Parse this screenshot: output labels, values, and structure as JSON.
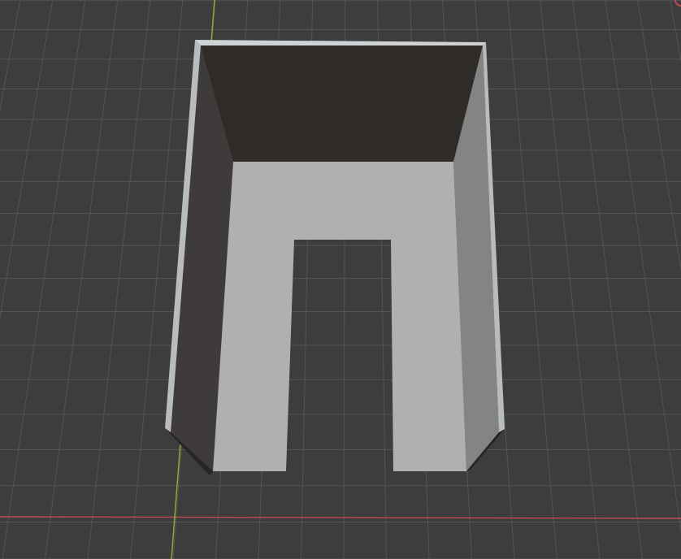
{
  "viewport": {
    "background_color": "#3d3d3d",
    "grid_color": "#545454",
    "x_axis_color": "#c14b55",
    "y_axis_color": "#8bb33a",
    "has_gizmo_dot": true
  },
  "object": {
    "kind": "open-box-with-u-cutout",
    "colors": {
      "rim": "#b9bcbe",
      "rim_edge": "#d0d3d5",
      "back_wall": "#2f2b29",
      "left_wall": "#3f3b3b",
      "right_wall": "#838585",
      "floor": "#aeb0b2",
      "cutout": "#3d3d3d",
      "bottom_edge": "#262424"
    }
  }
}
